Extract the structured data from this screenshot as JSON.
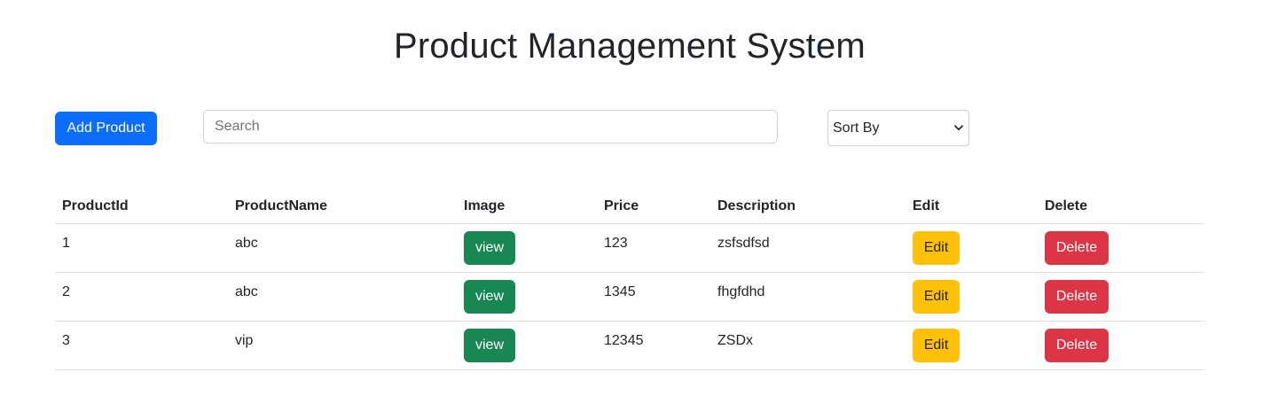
{
  "header": {
    "title": "Product Management System"
  },
  "toolbar": {
    "add_label": "Add Product",
    "search_placeholder": "Search",
    "search_value": "",
    "sort_label": "Sort By"
  },
  "table": {
    "headers": [
      "ProductId",
      "ProductName",
      "Image",
      "Price",
      "Description",
      "Edit",
      "Delete"
    ],
    "rows": [
      {
        "id": "1",
        "name": "abc",
        "image_label": "view",
        "price": "123",
        "description": "zsfsdfsd",
        "edit_label": "Edit",
        "delete_label": "Delete"
      },
      {
        "id": "2",
        "name": "abc",
        "image_label": "view",
        "price": "1345",
        "description": "fhgfdhd",
        "edit_label": "Edit",
        "delete_label": "Delete"
      },
      {
        "id": "3",
        "name": "vip",
        "image_label": "view",
        "price": "12345",
        "description": "ZSDx",
        "edit_label": "Edit",
        "delete_label": "Delete"
      }
    ]
  },
  "colors": {
    "primary": "#0d6efd",
    "success": "#198754",
    "warning": "#ffc107",
    "danger": "#dc3545"
  },
  "icons": {
    "sort_dropdown": "chevron-down-icon"
  }
}
